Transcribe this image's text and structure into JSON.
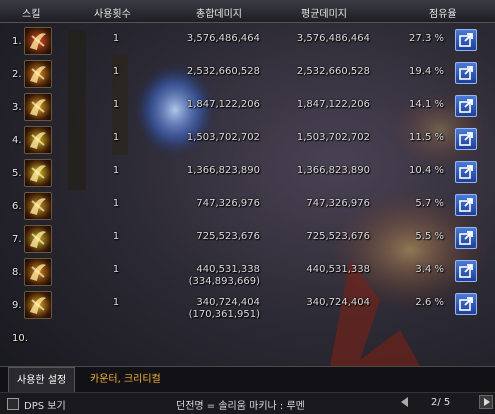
{
  "header": {
    "skill": "스킬",
    "use_count": "사용횟수",
    "total_damage": "총합데미지",
    "avg_damage": "평균데미지",
    "share": "점유율"
  },
  "rows": [
    {
      "rank": "1.",
      "count": "1",
      "total": "3,576,486,464",
      "total_sub": "",
      "avg": "3,576,486,464",
      "pct": "27.3 %",
      "icon": "flame-burst-icon",
      "color": "#e0501e"
    },
    {
      "rank": "2.",
      "count": "1",
      "total": "2,532,660,528",
      "total_sub": "",
      "avg": "2,532,660,528",
      "pct": "19.4 %",
      "icon": "slash-spark-icon",
      "color": "#e08a1e"
    },
    {
      "rank": "3.",
      "count": "1",
      "total": "1,847,122,206",
      "total_sub": "",
      "avg": "1,847,122,206",
      "pct": "14.1 %",
      "icon": "sword-strike-icon",
      "color": "#e0a21e"
    },
    {
      "rank": "4.",
      "count": "1",
      "total": "1,503,702,702",
      "total_sub": "",
      "avg": "1,503,702,702",
      "pct": "11.5 %",
      "icon": "spiral-blade-icon",
      "color": "#d2b01e"
    },
    {
      "rank": "5.",
      "count": "1",
      "total": "1,366,823,890",
      "total_sub": "",
      "avg": "1,366,823,890",
      "pct": "10.4 %",
      "icon": "golden-e-icon",
      "color": "#d8c21e"
    },
    {
      "rank": "6.",
      "count": "1",
      "total": "747,326,976",
      "total_sub": "",
      "avg": "747,326,976",
      "pct": "5.7 %",
      "icon": "dragon-head-icon",
      "color": "#c89a1e"
    },
    {
      "rank": "7.",
      "count": "1",
      "total": "725,523,676",
      "total_sub": "",
      "avg": "725,523,676",
      "pct": "5.5 %",
      "icon": "kanji-glyph-icon",
      "color": "#c8b41e"
    },
    {
      "rank": "8.",
      "count": "1",
      "total": "440,531,338",
      "total_sub": "(334,893,669)",
      "avg": "440,531,338",
      "pct": "3.4 %",
      "icon": "flow-kanji-icon",
      "color": "#d88a1e"
    },
    {
      "rank": "9.",
      "count": "1",
      "total": "340,724,404",
      "total_sub": "(170,361,951)",
      "avg": "340,724,404",
      "pct": "2.6 %",
      "icon": "flow-slash-icon",
      "color": "#e0a81e"
    },
    {
      "rank": "10.",
      "count": "",
      "total": "",
      "total_sub": "",
      "avg": "",
      "pct": "",
      "icon": "",
      "color": ""
    }
  ],
  "tabs": {
    "active": "사용한 설정",
    "second": "카운터, 크리티컬"
  },
  "footer": {
    "checkbox_label": "DPS 보기",
    "path": "던전명 = 솔리움 마키나 : 루멘",
    "page": "2/ 5"
  }
}
